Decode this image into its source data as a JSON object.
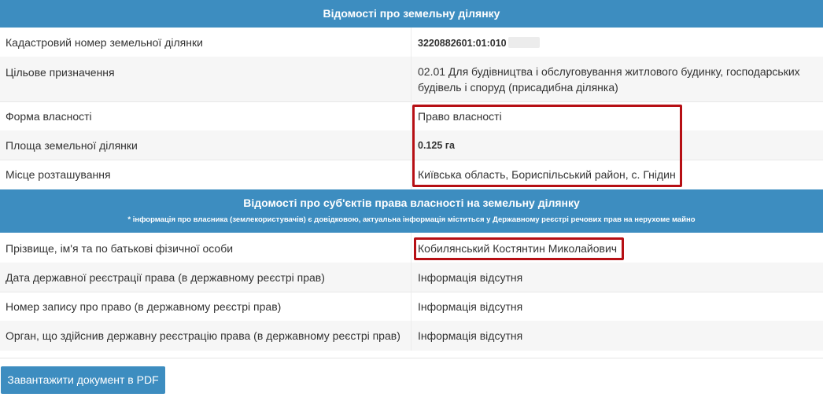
{
  "land_section": {
    "title": "Відомості про земельну ділянку",
    "rows": [
      {
        "label": "Кадастровий номер земельної ділянки",
        "value": "3220882601:01:010"
      },
      {
        "label": "Цільове призначення",
        "value": "02.01 Для будівництва і обслуговування житлового будинку, господарських будівель і споруд (присадибна ділянка)"
      },
      {
        "label": "Форма власності",
        "value": "Право власності"
      },
      {
        "label": "Площа земельної ділянки",
        "value": "0.125 га"
      },
      {
        "label": "Місце розташування",
        "value": "Київська область, Бориспільський район, с. Гнідин"
      }
    ]
  },
  "owner_section": {
    "title": "Відомості про суб'єктів права власності на земельну ділянку",
    "note": "* інформація про власника (землекористувачів) є довідковою, актуальна інформація міститься у Державному реєстрі речових прав на нерухоме майно",
    "rows": [
      {
        "label": "Прізвище, ім'я та по батькові фізичної особи",
        "value": "Кобилянський Костянтин Миколайович"
      },
      {
        "label": "Дата державної реєстрації права (в державному реєстрі прав)",
        "value": "Інформація відсутня"
      },
      {
        "label": "Номер запису про право (в державному реєстрі прав)",
        "value": "Інформація відсутня"
      },
      {
        "label": "Орган, що здійснив державну реєстрацію права (в державному реєстрі прав)",
        "value": "Інформація відсутня"
      }
    ]
  },
  "download_button": {
    "label": "Завантажити документ в PDF"
  },
  "colors": {
    "header": "#3d8dc0",
    "highlight": "#b60f14"
  }
}
